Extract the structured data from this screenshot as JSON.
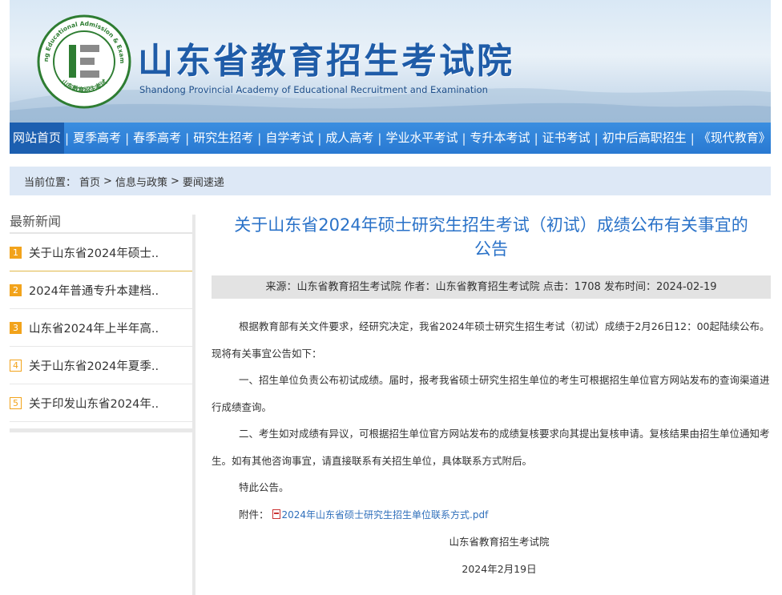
{
  "header": {
    "logo_ring_text": "Shandong Educational Admission & Examination",
    "logo_bottom_text": "山东教育招生考试",
    "title": "山东省教育招生考试院",
    "subtitle": "Shandong Provincial Academy of Educational Recruitment and Examination"
  },
  "nav": {
    "items": [
      "网站首页",
      "夏季高考",
      "春季高考",
      "研究生招考",
      "自学考试",
      "成人高考",
      "学业水平考试",
      "专升本考试",
      "证书考试",
      "初中后高职招生",
      "《现代教育》"
    ],
    "separator": "|"
  },
  "breadcrumb": {
    "prefix": "当前位置：",
    "items": [
      "首页",
      "信息与政策",
      "要闻速递"
    ],
    "sep": ">"
  },
  "sidebar": {
    "title": "最新新闻",
    "items": [
      {
        "num": "1",
        "text": "关于山东省2024年硕士.."
      },
      {
        "num": "2",
        "text": "2024年普通专升本建档.."
      },
      {
        "num": "3",
        "text": "山东省2024年上半年高.."
      },
      {
        "num": "4",
        "text": "关于山东省2024年夏季.."
      },
      {
        "num": "5",
        "text": "关于印发山东省2024年.."
      }
    ]
  },
  "article": {
    "title_line1": "关于山东省2024年硕士研究生招生考试（初试）成绩公布有关事宜的",
    "title_line2": "公告",
    "meta": "来源：山东省教育招生考试院 作者：山东省教育招生考试院 点击：1708 发布时间：2024-02-19",
    "paragraphs": [
      "根据教育部有关文件要求，经研究决定，我省2024年硕士研究生招生考试（初试）成绩于2月26日12：00起陆续公布。现将有关事宜公告如下：",
      "一、招生单位负责公布初试成绩。届时，报考我省硕士研究生招生单位的考生可根据招生单位官方网站发布的查询渠道进行成绩查询。",
      "二、考生如对成绩有异议，可根据招生单位官方网站发布的成绩复核要求向其提出复核申请。复核结果由招生单位通知考生。如有其他咨询事宜，请直接联系有关招生单位，具体联系方式附后。",
      "特此公告。"
    ],
    "attachment_label": "附件：",
    "attachment_link": "2024年山东省硕士研究生招生单位联系方式.pdf",
    "signature": "山东省教育招生考试院",
    "date": "2024年2月19日"
  },
  "colors": {
    "nav_bg": "#2979d2",
    "nav_active": "#1c5fb0",
    "title_blue": "#2a72c8",
    "crumb_bg": "#dde8f6",
    "badge_orange": "#f2a31b",
    "logo_green": "#2e7d32"
  }
}
